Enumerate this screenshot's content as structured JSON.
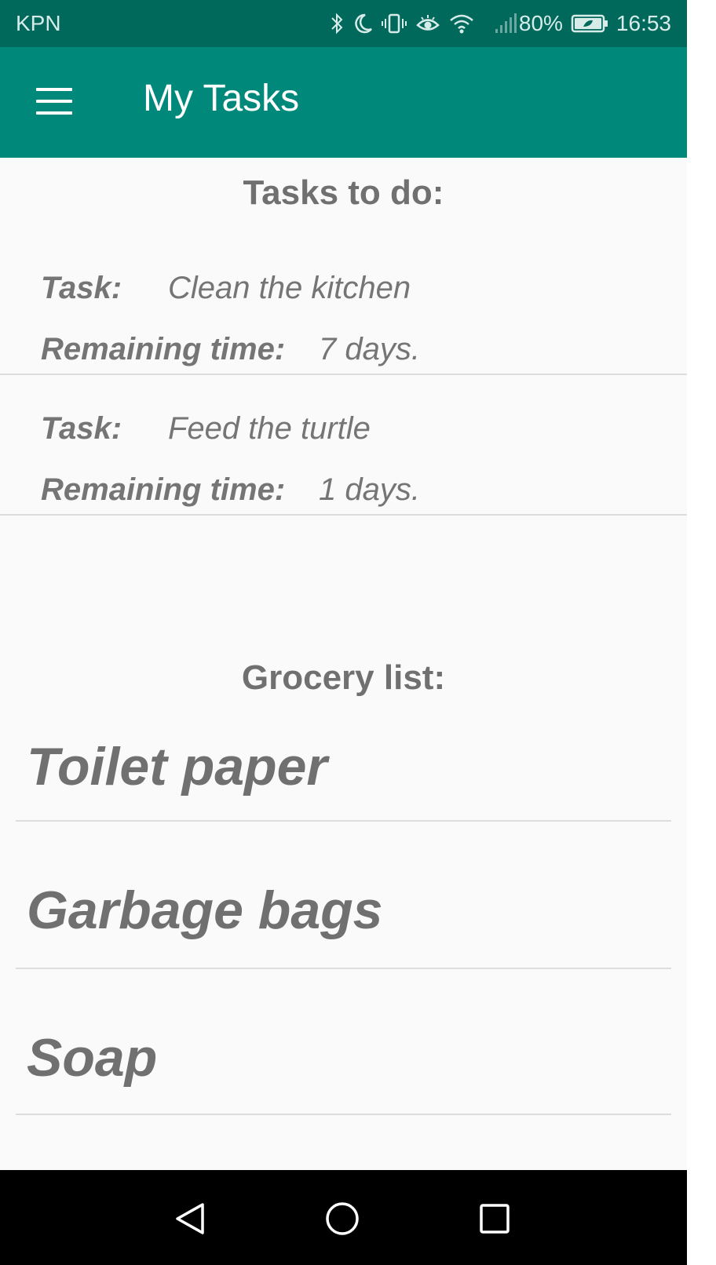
{
  "status_bar": {
    "carrier": "KPN",
    "battery": "80%",
    "time": "16:53",
    "icons": [
      "bluetooth-icon",
      "moon-icon",
      "vibrate-icon",
      "eye-icon",
      "wifi-icon",
      "signal-icon",
      "battery-icon"
    ]
  },
  "app_bar": {
    "title": "My Tasks",
    "menu_icon": "hamburger-menu-icon",
    "color": "#00897b"
  },
  "tasks": {
    "heading": "Tasks to do:",
    "task_label": "Task:",
    "remaining_label": "Remaining time:",
    "items": [
      {
        "task": "Clean the kitchen",
        "remaining": "7 days."
      },
      {
        "task": "Feed the turtle",
        "remaining": "1 days."
      }
    ]
  },
  "grocery": {
    "heading": "Grocery list:",
    "items": [
      "Toilet paper",
      "Garbage bags",
      "Soap"
    ]
  },
  "nav_bar": {
    "icons": [
      "back-icon",
      "home-icon",
      "recents-icon"
    ]
  }
}
